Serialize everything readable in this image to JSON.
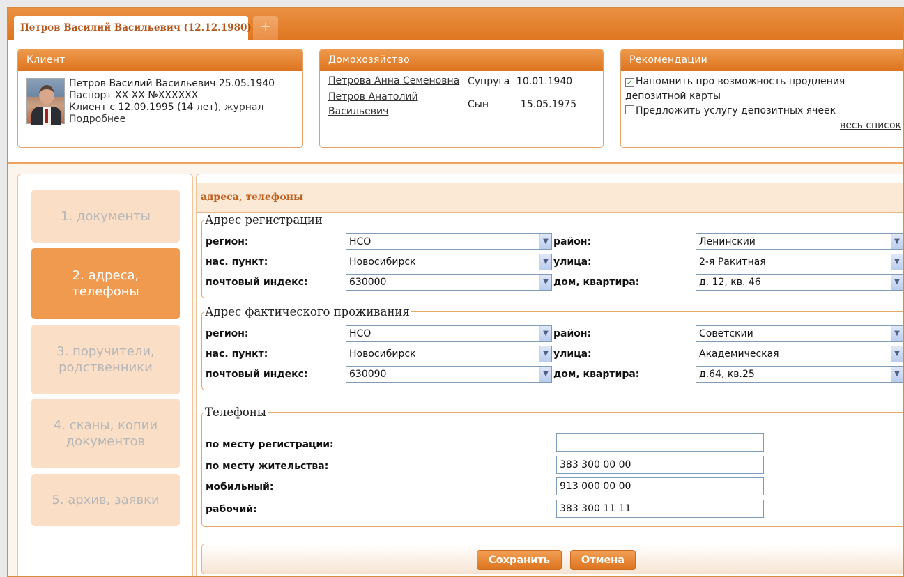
{
  "tabs": {
    "active_label": "Петров Василий Васильевич (12.12.1980)",
    "close_glyph": "×",
    "add_glyph": "+"
  },
  "client": {
    "header": "Клиент",
    "line1": "Петров Василий Васильевич  25.05.1940",
    "line2": "Паспорт XX XX №XXXXXX",
    "line3_prefix": "Клиент с 12.09.1995 (14 лет), ",
    "journal_link": "журнал",
    "more_link": "Подробнее"
  },
  "household": {
    "header": "Домохозяйство",
    "members": [
      {
        "name": "Петрова Анна Семеновна",
        "relation": "Супруга",
        "date": "10.01.1940"
      },
      {
        "name": "Петров Анатолий Васильевич",
        "relation": "Сын",
        "date": "15.05.1975"
      }
    ]
  },
  "recommendations": {
    "header": "Рекомендации",
    "items": [
      {
        "label": "Напомнить про возможность продления депозитной карты",
        "checked": true
      },
      {
        "label": "Предложить услугу депозитных ячеек",
        "checked": false
      }
    ],
    "all_link": "весь список"
  },
  "nav": {
    "items": [
      {
        "label": "1. документы",
        "active": false
      },
      {
        "label": "2. адреса, телефоны",
        "active": true
      },
      {
        "label": "3. поручители, родственники",
        "active": false
      },
      {
        "label": "4. сканы, копии документов",
        "active": false
      },
      {
        "label": "5. архив, заявки",
        "active": false
      }
    ]
  },
  "section_title": "адреса, телефоны",
  "labels": {
    "region": "регион:",
    "district": "район:",
    "locality": "нас. пункт:",
    "street": "улица:",
    "postcode": "почтовый индекс:",
    "house": "дом, квартира:"
  },
  "registration": {
    "legend": "Адрес регистрации",
    "region": "НСО",
    "district": "Ленинский",
    "locality": "Новосибирск",
    "street": "2-я Ракитная",
    "postcode": "630000",
    "house": "д. 12, кв. 46"
  },
  "actual": {
    "legend": "Адрес фактического проживания",
    "region": "НСО",
    "district": "Советский",
    "locality": "Новосибирск",
    "street": "Академическая",
    "postcode": "630090",
    "house": "д.64, кв.25"
  },
  "phones": {
    "legend": "Телефоны",
    "registration_label": "по месту регистрации:",
    "registration_value": "",
    "residence_label": "по месту жительства:",
    "residence_value": "383 300 00 00",
    "mobile_label": "мобильный:",
    "mobile_value": "913 000 00 00",
    "work_label": "рабочий:",
    "work_value": "383 300 11 11"
  },
  "buttons": {
    "save": "Сохранить",
    "cancel": "Отмена"
  },
  "colors": {
    "accent": "#e07a25",
    "nav_active": "#f09a4f",
    "nav_inactive": "#fadec6"
  }
}
